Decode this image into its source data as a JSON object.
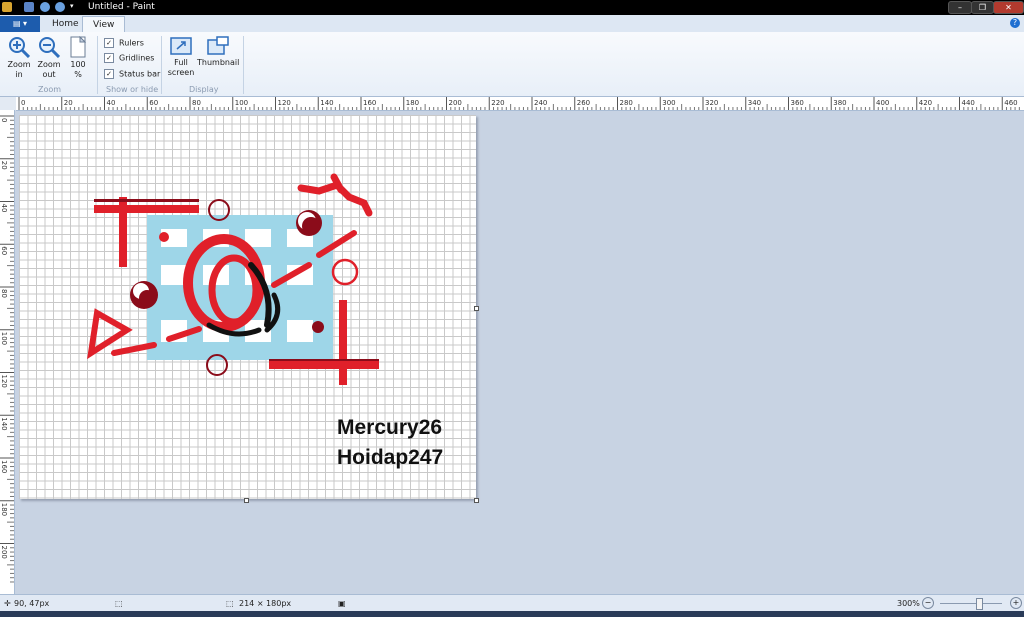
{
  "window": {
    "title": "Untitled - Paint",
    "controls": {
      "minimize": "–",
      "maximize": "❐",
      "close": "✕"
    }
  },
  "tabs": {
    "app_menu": "▤ ▾",
    "home": "Home",
    "view": "View",
    "help": "?"
  },
  "ribbon": {
    "zoom_group": {
      "label": "Zoom",
      "zoom_in": [
        "Zoom",
        "in"
      ],
      "zoom_out": [
        "Zoom",
        "out"
      ],
      "hundred": [
        "100",
        "%"
      ]
    },
    "show_hide_group": {
      "label": "Show or hide",
      "rulers": "Rulers",
      "gridlines": "Gridlines",
      "status_bar": "Status bar"
    },
    "display_group": {
      "label": "Display",
      "full_screen": [
        "Full",
        "screen"
      ],
      "thumbnail": "Thumbnail"
    }
  },
  "ruler": {
    "horizontal": [
      "0",
      "20",
      "40",
      "60",
      "80",
      "100",
      "120",
      "140",
      "160",
      "180",
      "200",
      "220",
      "240",
      "260",
      "280",
      "300",
      "320",
      "340",
      "360",
      "380",
      "400",
      "420",
      "440",
      "460"
    ],
    "vertical": [
      "0",
      "20",
      "40",
      "60",
      "80",
      "100",
      "120",
      "140",
      "160",
      "180",
      "200"
    ]
  },
  "canvas": {
    "text_line1": "Mercury26",
    "text_line2": "Hoidap247"
  },
  "status": {
    "cursor_position": "90, 47px",
    "image_size": "214 × 180px",
    "zoom_level": "300%",
    "zoom_minus": "−",
    "zoom_plus": "+"
  },
  "colors": {
    "accent_red": "#e0202a",
    "dark_red": "#8b0c1a",
    "light_blue": "#9ed6e8",
    "ribbon_blue": "#1d5cad"
  }
}
